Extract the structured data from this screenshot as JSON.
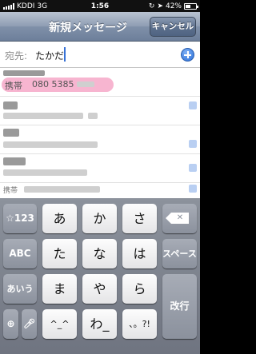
{
  "status_bar": {
    "carrier": "KDDI",
    "network": "3G",
    "time": "1:56",
    "battery": "42%"
  },
  "nav": {
    "title": "新規メッセージ",
    "cancel_label": "キャンセル"
  },
  "to_field": {
    "label": "宛先:",
    "value": "たかだ"
  },
  "results": {
    "highlighted_label": "携帯",
    "highlighted_number": "080 5385",
    "last_row_label": "携帯"
  },
  "keyboard": {
    "row1": [
      "☆123",
      "あ",
      "か",
      "さ"
    ],
    "row2": [
      "ABC",
      "た",
      "な",
      "は",
      "スペース"
    ],
    "row3": [
      "あいう",
      "ま",
      "や",
      "ら",
      "改行"
    ],
    "row4": [
      "^_^",
      "わ_",
      "、。?!"
    ]
  },
  "colors": {
    "nav": "#7f90a9",
    "accent_blue": "#2a6fd8",
    "highlight": "#f078aa"
  }
}
